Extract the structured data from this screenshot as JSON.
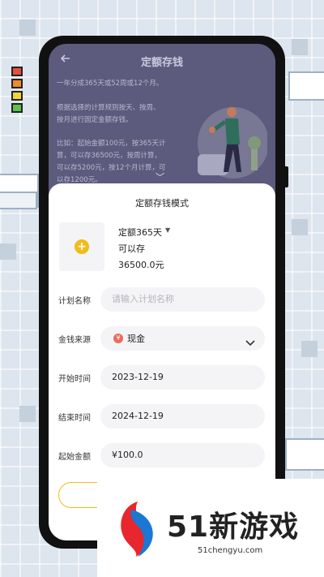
{
  "header": {
    "title": "定额存钱"
  },
  "intro": {
    "lines": [
      "一年分成365天或52周或12个月。",
      "根据选择的计算规则按天、按周、",
      "按月进行固定金额存钱。",
      "比如：起始金额100元，按365天计",
      "算，可以存36500元，按周计算，",
      "可以存5200元，按12个月计算，可",
      "以存1200元。"
    ]
  },
  "sheet": {
    "title": "定额存钱模式",
    "mode_label": "定额365天",
    "can_save_label": "可以存",
    "amount": "36500.0元"
  },
  "form": {
    "plan_name_label": "计划名称",
    "plan_name_placeholder": "请输入计划名称",
    "source_label": "金钱来源",
    "source_value": "现金",
    "source_icon": "¥",
    "start_label": "开始时间",
    "start_value": "2023-12-19",
    "end_label": "结束时间",
    "end_value": "2024-12-19",
    "amount_label": "起始金额",
    "amount_value": "¥100.0"
  },
  "watermark": {
    "logo_text": "51新游戏",
    "url": "51chengyu.com"
  },
  "colors": {
    "accent": "#f0bc17",
    "header_bg": "#5c5b7d",
    "cash_icon": "#ea6b5e"
  }
}
